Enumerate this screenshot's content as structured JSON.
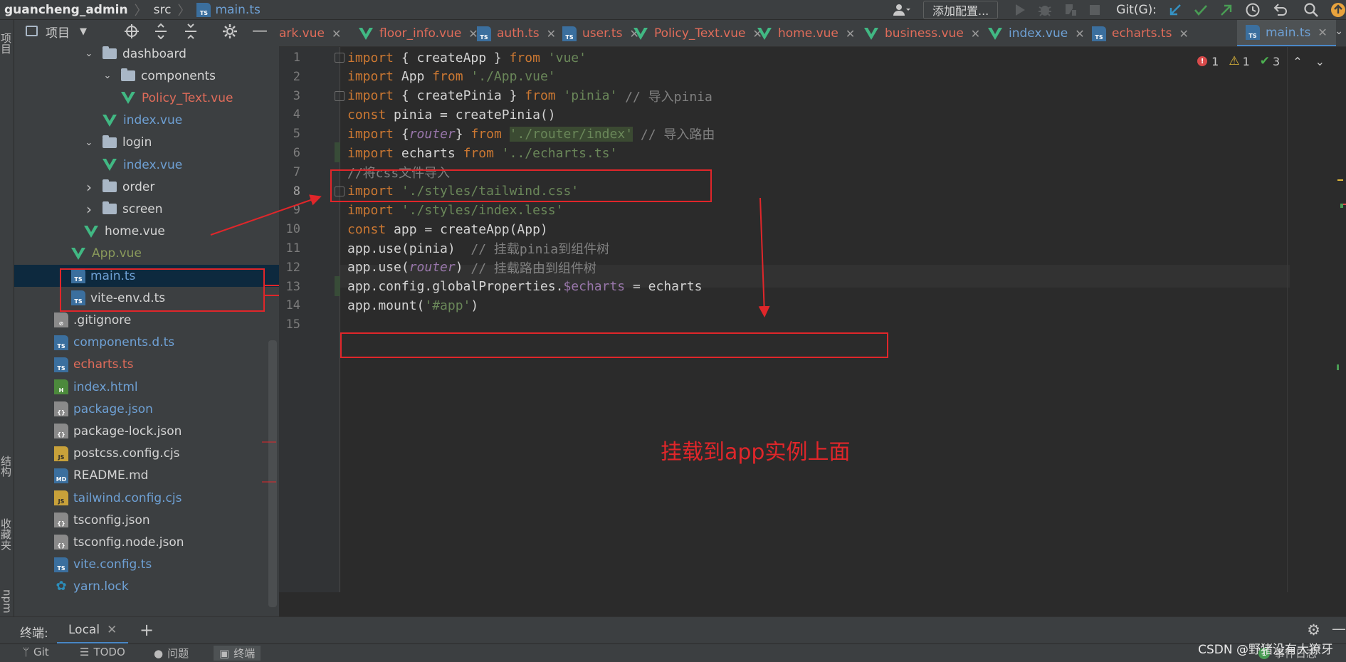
{
  "breadcrumb": {
    "project": "guancheng_admin",
    "folder": "src",
    "file": "main.ts"
  },
  "navbar": {
    "add_config_label": "添加配置...",
    "git_label": "Git(G):"
  },
  "left_strip": {
    "project_tab": "项目",
    "structure_tab": "结构",
    "favorites_tab": "收藏夹",
    "npm_tab": "npm"
  },
  "project_panel": {
    "title": "项目",
    "tree": [
      {
        "label": "dashboard",
        "kind": "folder",
        "expanded": true,
        "depth": 1,
        "color": "normal"
      },
      {
        "label": "components",
        "kind": "folder",
        "expanded": true,
        "depth": 2,
        "color": "normal"
      },
      {
        "label": "Policy_Text.vue",
        "kind": "vue",
        "depth": 3,
        "color": "red"
      },
      {
        "label": "index.vue",
        "kind": "vue",
        "depth": 2,
        "color": "blue"
      },
      {
        "label": "login",
        "kind": "folder",
        "expanded": true,
        "depth": 1,
        "color": "normal"
      },
      {
        "label": "index.vue",
        "kind": "vue",
        "depth": 2,
        "color": "blue"
      },
      {
        "label": "order",
        "kind": "folder",
        "expanded": false,
        "depth": 1,
        "color": "normal"
      },
      {
        "label": "screen",
        "kind": "folder",
        "expanded": false,
        "depth": 1,
        "color": "normal"
      },
      {
        "label": "home.vue",
        "kind": "vue",
        "depth": 1,
        "color": "normal"
      },
      {
        "label": "App.vue",
        "kind": "vue",
        "depth": 0,
        "color": "olive"
      },
      {
        "label": "main.ts",
        "kind": "ts",
        "depth": 0,
        "color": "blue",
        "selected": true
      },
      {
        "label": "vite-env.d.ts",
        "kind": "ts",
        "depth": 0,
        "color": "normal"
      },
      {
        "label": ".gitignore",
        "kind": "git",
        "depth": -1,
        "color": "normal"
      },
      {
        "label": "components.d.ts",
        "kind": "ts",
        "depth": -1,
        "color": "blue"
      },
      {
        "label": "echarts.ts",
        "kind": "ts",
        "depth": -1,
        "color": "red"
      },
      {
        "label": "index.html",
        "kind": "html",
        "depth": -1,
        "color": "blue"
      },
      {
        "label": "package.json",
        "kind": "json",
        "depth": -1,
        "color": "blue"
      },
      {
        "label": "package-lock.json",
        "kind": "json",
        "depth": -1,
        "color": "normal"
      },
      {
        "label": "postcss.config.cjs",
        "kind": "js",
        "depth": -1,
        "color": "normal"
      },
      {
        "label": "README.md",
        "kind": "md",
        "depth": -1,
        "color": "normal"
      },
      {
        "label": "tailwind.config.cjs",
        "kind": "js",
        "depth": -1,
        "color": "blue"
      },
      {
        "label": "tsconfig.json",
        "kind": "json",
        "depth": -1,
        "color": "normal"
      },
      {
        "label": "tsconfig.node.json",
        "kind": "json",
        "depth": -1,
        "color": "normal"
      },
      {
        "label": "vite.config.ts",
        "kind": "ts",
        "depth": -1,
        "color": "blue"
      },
      {
        "label": "yarn.lock",
        "kind": "yarn",
        "depth": -1,
        "color": "blue"
      }
    ]
  },
  "tabs": [
    {
      "label": "ark.vue",
      "kind": "none",
      "color": "red"
    },
    {
      "label": "floor_info.vue",
      "kind": "vue",
      "color": "red"
    },
    {
      "label": "auth.ts",
      "kind": "ts",
      "color": "red"
    },
    {
      "label": "user.ts",
      "kind": "ts",
      "color": "red"
    },
    {
      "label": "Policy_Text.vue",
      "kind": "vue",
      "color": "red"
    },
    {
      "label": "home.vue",
      "kind": "vue",
      "color": "red"
    },
    {
      "label": "business.vue",
      "kind": "vue",
      "color": "red"
    },
    {
      "label": "index.vue",
      "kind": "vue",
      "color": "blue"
    },
    {
      "label": "echarts.ts",
      "kind": "ts",
      "color": "red"
    },
    {
      "label": "main.ts",
      "kind": "ts",
      "color": "blue",
      "active": true
    }
  ],
  "inspections": {
    "errors": "1",
    "warnings": "1",
    "ok": "3"
  },
  "code": [
    [
      {
        "t": "import",
        "c": "kw"
      },
      {
        "t": " { createApp } "
      },
      {
        "t": "from",
        "c": "kw"
      },
      {
        "t": " "
      },
      {
        "t": "'vue'",
        "c": "str"
      }
    ],
    [
      {
        "t": "import",
        "c": "kw"
      },
      {
        "t": " App "
      },
      {
        "t": "from",
        "c": "kw"
      },
      {
        "t": " "
      },
      {
        "t": "'./App.vue'",
        "c": "str"
      }
    ],
    [
      {
        "t": "import",
        "c": "kw"
      },
      {
        "t": " { createPinia } "
      },
      {
        "t": "from",
        "c": "kw"
      },
      {
        "t": " "
      },
      {
        "t": "'pinia'",
        "c": "str"
      },
      {
        "t": " // 导入pinia",
        "c": "cm"
      }
    ],
    [
      {
        "t": "const",
        "c": "kw"
      },
      {
        "t": " pinia = createPinia()"
      }
    ],
    [
      {
        "t": "import",
        "c": "kw"
      },
      {
        "t": " {"
      },
      {
        "t": "router",
        "c": "purp ital"
      },
      {
        "t": "} "
      },
      {
        "t": "from",
        "c": "kw"
      },
      {
        "t": " "
      },
      {
        "t": "'./router/index'",
        "c": "str strhl"
      },
      {
        "t": " // 导入路由",
        "c": "cm"
      }
    ],
    [
      {
        "t": "import",
        "c": "kw"
      },
      {
        "t": " echarts "
      },
      {
        "t": "from",
        "c": "kw"
      },
      {
        "t": " "
      },
      {
        "t": "'../echarts.ts'",
        "c": "str"
      }
    ],
    [
      {
        "t": "//将css文件导入",
        "c": "cm"
      }
    ],
    [
      {
        "t": "import",
        "c": "kw"
      },
      {
        "t": " "
      },
      {
        "t": "'./styles/tailwind.css'",
        "c": "str"
      }
    ],
    [
      {
        "t": "import",
        "c": "kw"
      },
      {
        "t": " "
      },
      {
        "t": "'./styles/index.less'",
        "c": "str"
      }
    ],
    [
      {
        "t": "const",
        "c": "kw"
      },
      {
        "t": " app = createApp(App)"
      }
    ],
    [
      {
        "t": "app.use(pinia)  "
      },
      {
        "t": "// 挂载pinia到组件树",
        "c": "cm"
      }
    ],
    [
      {
        "t": "app.use("
      },
      {
        "t": "router",
        "c": "purp ital"
      },
      {
        "t": ") "
      },
      {
        "t": "// 挂载路由到组件树",
        "c": "cm"
      }
    ],
    [
      {
        "t": "app.config.globalProperties."
      },
      {
        "t": "$echarts",
        "c": "purp"
      },
      {
        "t": " = echarts"
      }
    ],
    [
      {
        "t": "app.mount("
      },
      {
        "t": "'#app'",
        "c": "str"
      },
      {
        "t": ")"
      }
    ],
    []
  ],
  "line_numbers": [
    "1",
    "2",
    "3",
    "4",
    "5",
    "6",
    "7",
    "8",
    "9",
    "10",
    "11",
    "12",
    "13",
    "14",
    "15"
  ],
  "annotation": {
    "text": "挂载到app实例上面"
  },
  "terminal": {
    "label": "终端:",
    "tab": "Local"
  },
  "status": {
    "git": "Git",
    "todo": "TODO",
    "problems": "问题",
    "terminal": "终端",
    "events": "事件日志"
  },
  "watermark": "CSDN @野猪没有大獠牙"
}
